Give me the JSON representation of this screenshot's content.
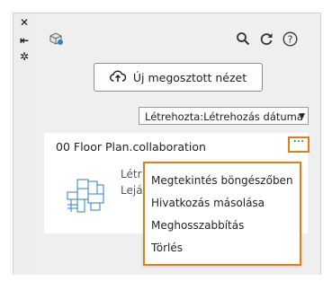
{
  "sidebar_strip": {
    "icons": [
      "close-icon",
      "collapse-icon",
      "settings-icon"
    ],
    "glyphs": [
      "✕",
      "⇤",
      "✲"
    ]
  },
  "toolbar": {
    "icons": [
      "app-logo-icon",
      "search-icon",
      "refresh-icon",
      "help-icon"
    ]
  },
  "share_button": {
    "label": "Új megosztott nézet",
    "icon": "cloud-upload-icon"
  },
  "sort": {
    "selected": "Létrehozta:Létrehozás dátuma"
  },
  "card": {
    "title": "00 Floor Plan.collaboration",
    "more_label": "···",
    "meta_line1": "Létr",
    "meta_line2": "Lejá"
  },
  "context_menu": {
    "items": [
      "Megtekintés böngészőben",
      "Hivatkozás másolása",
      "Meghosszabbítás",
      "Törlés"
    ]
  },
  "colors": {
    "highlight": "#e07e1e",
    "panel_bg": "#efefef"
  }
}
